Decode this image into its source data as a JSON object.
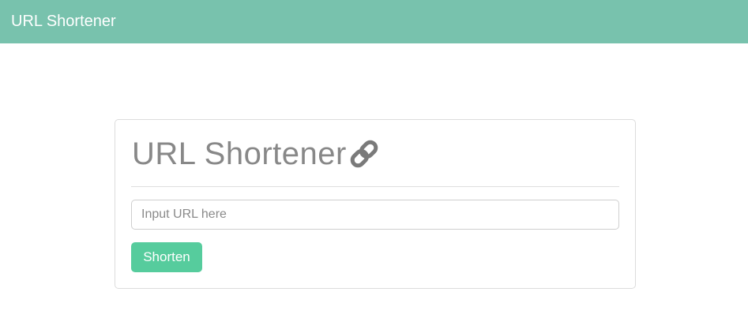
{
  "navbar": {
    "brand": "URL Shortener",
    "background_color": "#78c2ad"
  },
  "card": {
    "title": "URL Shortener",
    "title_icon": "link-icon",
    "input": {
      "value": "",
      "placeholder": "Input URL here"
    },
    "submit_button": {
      "label": "Shorten",
      "color": "#56cc9d"
    }
  }
}
